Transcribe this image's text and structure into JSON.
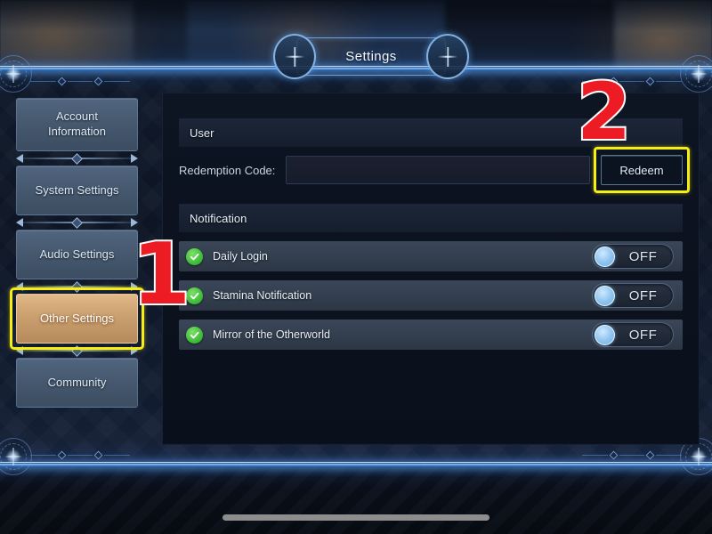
{
  "window": {
    "title": "Settings"
  },
  "sidebar": {
    "items": [
      {
        "label": "Account\nInformation",
        "active": false,
        "name": "account-information"
      },
      {
        "label": "System Settings",
        "active": false,
        "name": "system-settings"
      },
      {
        "label": "Audio Settings",
        "active": false,
        "name": "audio-settings"
      },
      {
        "label": "Other Settings",
        "active": true,
        "name": "other-settings"
      },
      {
        "label": "Community",
        "active": false,
        "name": "community"
      }
    ]
  },
  "content": {
    "user_section": {
      "heading": "User",
      "redemption": {
        "label": "Redemption Code:",
        "value": "",
        "placeholder": "",
        "button_label": "Redeem"
      }
    },
    "notification_section": {
      "heading": "Notification",
      "rows": [
        {
          "label": "Daily Login",
          "state": "OFF",
          "icon": "check-circle-icon"
        },
        {
          "label": "Stamina Notification",
          "state": "OFF",
          "icon": "check-circle-icon"
        },
        {
          "label": "Mirror of the Otherworld",
          "state": "OFF",
          "icon": "check-circle-icon"
        }
      ]
    }
  },
  "annotations": {
    "step_one": "1",
    "step_two": "2"
  },
  "colors": {
    "highlight": "#f5ee15",
    "annotation": "#ed1c24",
    "active_nav": "#cda271",
    "toggle_on_check": "#3fbf3a",
    "frame_glow": "#5aa0f0"
  }
}
